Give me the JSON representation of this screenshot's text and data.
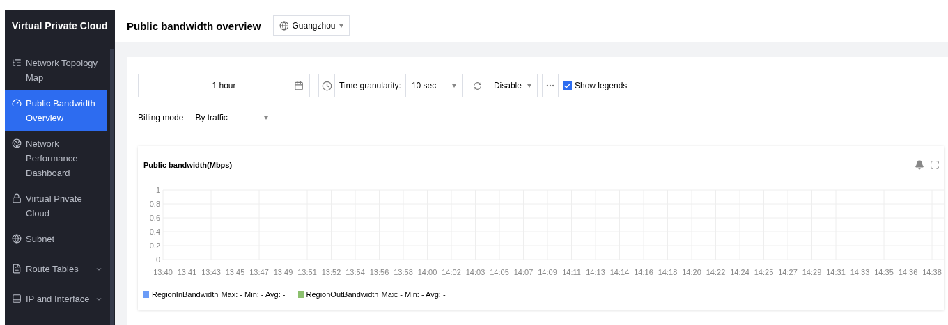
{
  "sidebar": {
    "title": "Virtual Private Cloud",
    "items": [
      {
        "label": "Network Topology Map",
        "selected": false,
        "expandable": false
      },
      {
        "label": "Public Bandwidth Overview",
        "selected": true,
        "expandable": false
      },
      {
        "label": "Network Performance Dashboard",
        "selected": false,
        "expandable": false
      },
      {
        "label": "Virtual Private Cloud",
        "selected": false,
        "expandable": false
      },
      {
        "label": "Subnet",
        "selected": false,
        "expandable": false
      },
      {
        "label": "Route Tables",
        "selected": false,
        "expandable": true
      },
      {
        "label": "IP and Interface",
        "selected": false,
        "expandable": true
      }
    ]
  },
  "header": {
    "title": "Public bandwidth overview",
    "region": "Guangzhou"
  },
  "toolbar": {
    "time_range": "1 hour",
    "granularity_label": "Time granularity:",
    "granularity": "10 sec",
    "refresh": "Disable",
    "show_legends": {
      "label": "Show legends",
      "checked": true
    }
  },
  "billing": {
    "label": "Billing mode",
    "value": "By traffic"
  },
  "chart_panel": {
    "title": "Public bandwidth(Mbps)",
    "chart_data": {
      "type": "line",
      "grid": true,
      "ylim": [
        0,
        1
      ],
      "yticks": [
        0,
        0.2,
        0.4,
        0.6,
        0.8,
        1
      ],
      "categories": [
        "13:40",
        "13:41",
        "13:43",
        "13:45",
        "13:47",
        "13:49",
        "13:51",
        "13:52",
        "13:54",
        "13:56",
        "13:58",
        "14:00",
        "14:02",
        "14:03",
        "14:05",
        "14:07",
        "14:09",
        "14:11",
        "14:13",
        "14:14",
        "14:16",
        "14:18",
        "14:20",
        "14:22",
        "14:24",
        "14:25",
        "14:27",
        "14:29",
        "14:31",
        "14:33",
        "14:35",
        "14:36",
        "14:38"
      ],
      "series": [
        {
          "name": "RegionInBandwidth",
          "color": "#6b9cf7",
          "values": [
            null,
            null,
            null,
            null,
            null,
            null,
            null,
            null,
            null,
            null,
            null,
            null,
            null,
            null,
            null,
            null,
            null,
            null,
            null,
            null,
            null,
            null,
            null,
            null,
            null,
            null,
            null,
            null,
            null,
            null,
            null,
            null,
            null
          ]
        },
        {
          "name": "RegionOutBandwidth",
          "color": "#8cc06e",
          "values": [
            null,
            null,
            null,
            null,
            null,
            null,
            null,
            null,
            null,
            null,
            null,
            null,
            null,
            null,
            null,
            null,
            null,
            null,
            null,
            null,
            null,
            null,
            null,
            null,
            null,
            null,
            null,
            null,
            null,
            null,
            null,
            null,
            null
          ]
        }
      ]
    },
    "legend_stats": [
      "Max: - Min: - Avg: -",
      "Max: - Min: - Avg: -"
    ]
  }
}
